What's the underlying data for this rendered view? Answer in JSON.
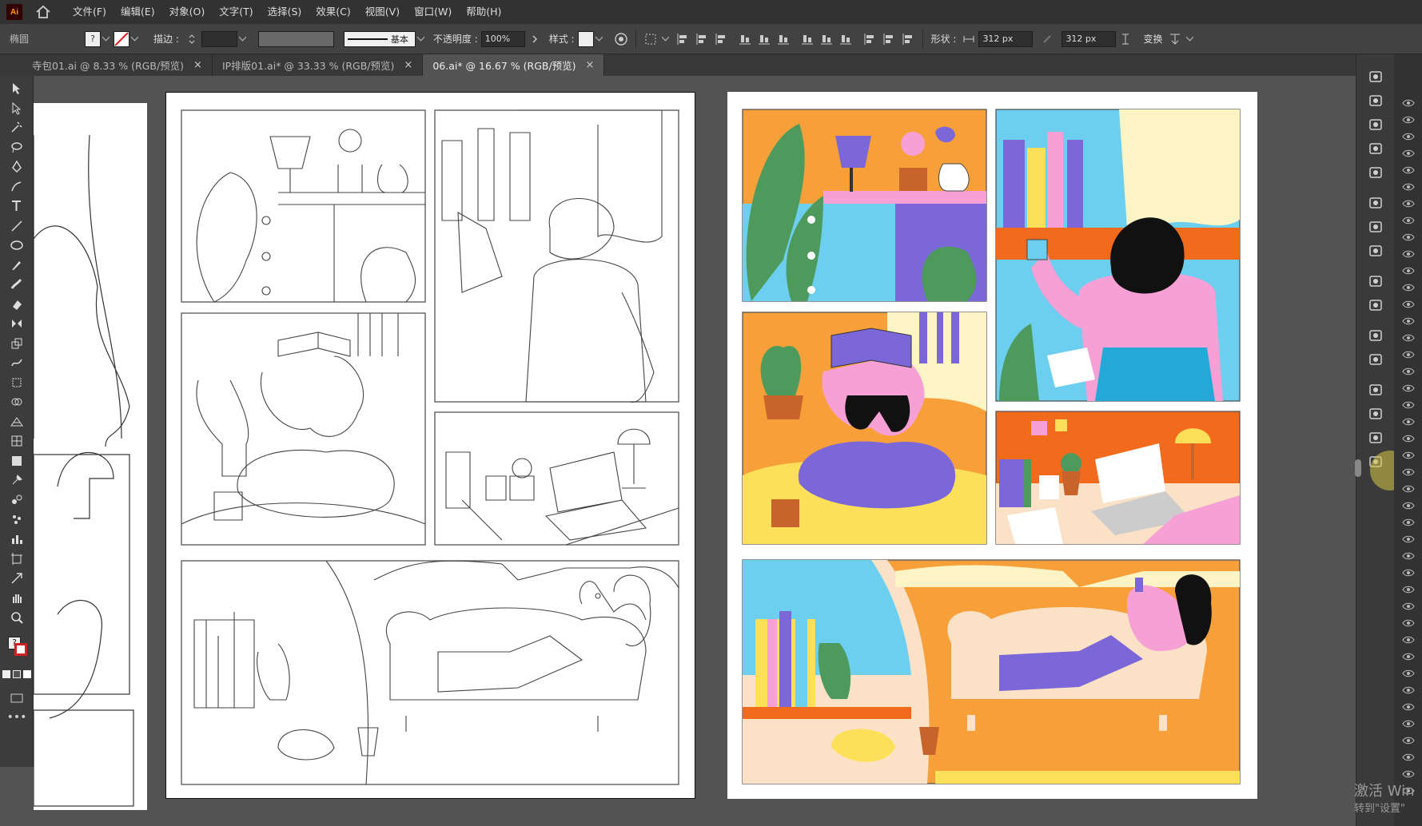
{
  "app": {
    "logo": "Ai"
  },
  "menu": [
    "文件(F)",
    "编辑(E)",
    "对象(O)",
    "文字(T)",
    "选择(S)",
    "效果(C)",
    "视图(V)",
    "窗口(W)",
    "帮助(H)"
  ],
  "control_bar": {
    "object_type": "椭圆",
    "stroke_label": "描边 :",
    "stroke_style": "基本",
    "opacity_label": "不透明度 :",
    "opacity_value": "100%",
    "style_label": "样式 :",
    "shape_label": "形状 :",
    "width_value": "312 px",
    "height_value": "312 px",
    "transform_label": "变换"
  },
  "tabs": [
    {
      "label": "寺包01.ai @ 8.33 % (RGB/预览)",
      "active": false
    },
    {
      "label": "IP排版01.ai* @ 33.33 % (RGB/预览)",
      "active": false
    },
    {
      "label": "06.ai* @ 16.67 % (RGB/预览)",
      "active": true
    }
  ],
  "tools": [
    "selection-tool-icon",
    "direct-selection-tool-icon",
    "magic-wand-icon",
    "lasso-icon",
    "pen-tool-icon",
    "curvature-tool-icon",
    "type-tool-icon",
    "line-tool-icon",
    "ellipse-tool-icon",
    "paintbrush-icon",
    "blob-brush-icon",
    "eraser-icon",
    "reflect-tool-icon",
    "scale-tool-icon",
    "warp-tool-icon",
    "free-transform-icon",
    "shape-builder-icon",
    "perspective-grid-icon",
    "mesh-tool-icon",
    "gradient-tool-icon",
    "eyedropper-icon",
    "blend-tool-icon",
    "symbol-sprayer-icon",
    "column-graph-icon",
    "artboard-tool-icon",
    "slice-tool-icon",
    "hand-tool-icon",
    "zoom-tool-icon"
  ],
  "colors": {
    "orange": "#f7a03a",
    "deep_orange": "#f26b1d",
    "purple": "#7b67d8",
    "pink": "#f6a0d6",
    "cyan": "#6ccff0",
    "green": "#4d9a5c",
    "yellow": "#fde05a",
    "cream": "#fdf4c5"
  },
  "watermark": {
    "line1": "激活 Win",
    "line2": "转到\"设置\""
  }
}
